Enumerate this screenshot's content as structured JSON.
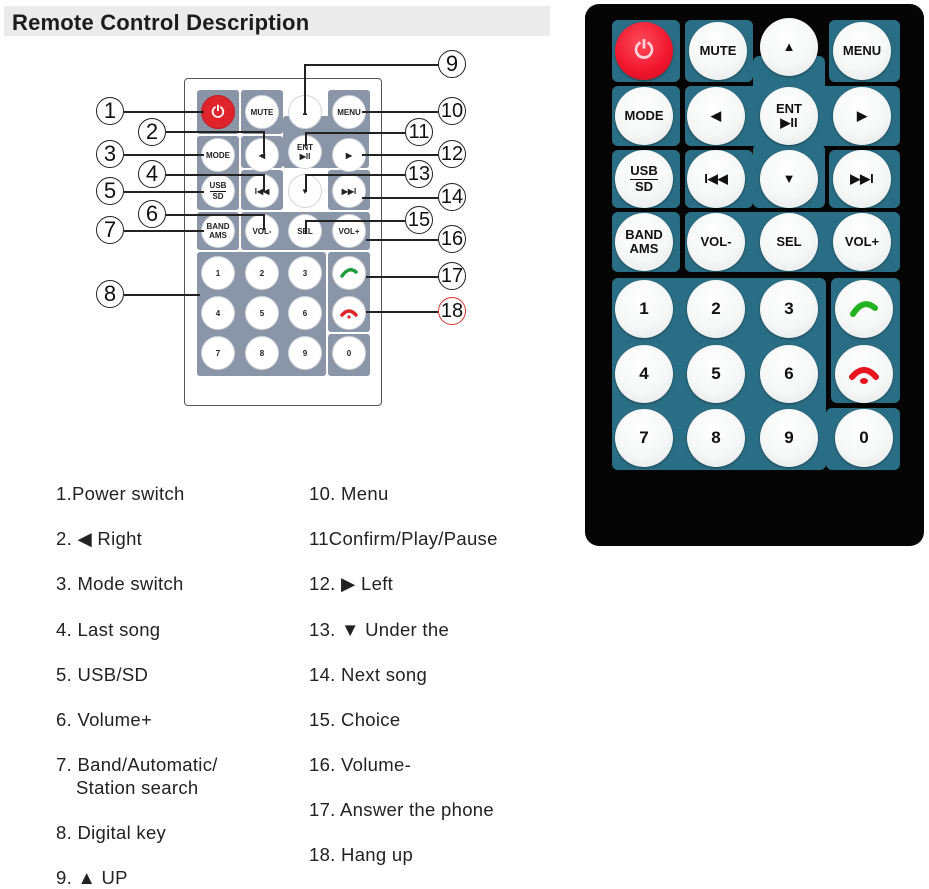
{
  "header": {
    "title": "Remote Control Description"
  },
  "diagram": {
    "callouts": [
      "1",
      "2",
      "3",
      "4",
      "5",
      "6",
      "7",
      "8",
      "9",
      "10",
      "11",
      "12",
      "13",
      "14",
      "15",
      "16",
      "17",
      "18"
    ],
    "buttons": {
      "power": "⏻",
      "mute": "MUTE",
      "up": "▲",
      "menu": "MENU",
      "mode": "MODE",
      "left": "◀",
      "ent_top": "ENT",
      "ent_bottom": "▶II",
      "right": "▶",
      "usb": "USB",
      "sd": "SD",
      "prev": "I◀◀",
      "down": "▼",
      "next": "▶▶I",
      "band": "BAND",
      "ams": "AMS",
      "vol_minus": "VOL-",
      "sel": "SEL",
      "vol_plus": "VOL+",
      "digits": [
        "1",
        "2",
        "3",
        "4",
        "5",
        "6",
        "7",
        "8",
        "9",
        "0"
      ],
      "answer_icon": "phone-answer",
      "hangup_icon": "phone-hangup"
    }
  },
  "legend": {
    "left": [
      "1.Power switch",
      "2. ◀ Right",
      "3. Mode switch",
      "4. Last song",
      "5. USB/SD",
      "6. Volume+",
      "7. Band/Automatic/",
      "Station search",
      "8. Digital key",
      "9. ▲ UP"
    ],
    "right": [
      "10. Menu",
      "11Confirm/Play/Pause",
      "12. ▶ Left",
      "13. ▼ Under the",
      "14. Next song",
      "15. Choice",
      "16. Volume-",
      "17. Answer the phone",
      "18. Hang up"
    ]
  },
  "photo": {
    "colors": {
      "body": "#050505",
      "panel": "#2a6e85",
      "power": "#f0152c",
      "answer": "#22b322",
      "hangup": "#e8141f"
    }
  }
}
